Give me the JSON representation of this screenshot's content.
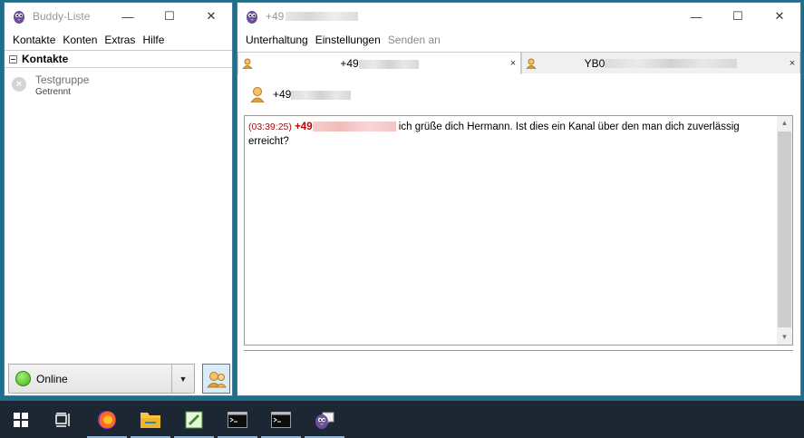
{
  "buddy_window": {
    "title": "Buddy-Liste",
    "menu": [
      "Kontakte",
      "Konten",
      "Extras",
      "Hilfe"
    ],
    "group_header": "Kontakte",
    "buddy": {
      "name": "Testgruppe",
      "status": "Getrennt"
    },
    "status_selector": {
      "label": "Online"
    }
  },
  "conversation_window": {
    "title_prefix": "+49",
    "menu": [
      {
        "label": "Unterhaltung",
        "enabled": true
      },
      {
        "label": "Einstellungen",
        "enabled": true
      },
      {
        "label": "Senden an",
        "enabled": false
      }
    ],
    "tabs": [
      {
        "label": "+49",
        "close": "×",
        "active": true
      },
      {
        "label": "YB0",
        "close": "×",
        "active": false
      }
    ],
    "header_name": "+49",
    "messages": [
      {
        "timestamp": "(03:39:25)",
        "sender_prefix": "+49",
        "text": "ich grüße dich Hermann. Ist dies ein Kanal über den man dich zuverlässig erreicht?"
      }
    ]
  },
  "window_controls": {
    "minimize": "—",
    "maximize": "☐",
    "close": "✕"
  },
  "taskbar": {
    "items": [
      "start-icon",
      "task-view-icon",
      "firefox-icon",
      "file-explorer-icon",
      "notepad-icon",
      "terminal-icon",
      "terminal-icon",
      "pidgin-icon"
    ]
  },
  "colors": {
    "desktop": "#1e6f8c",
    "taskbar": "#1c2733",
    "sender": "#c00000",
    "online": "#3fb418"
  }
}
